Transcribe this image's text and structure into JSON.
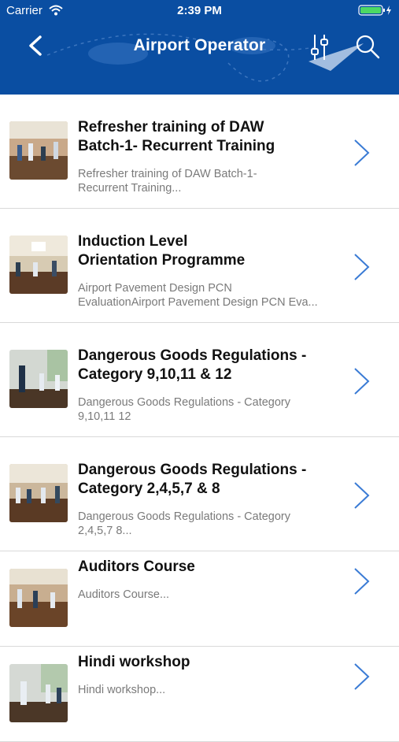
{
  "status": {
    "carrier": "Carrier",
    "time": "2:39 PM"
  },
  "nav": {
    "title": "Airport Operator"
  },
  "items": [
    {
      "title_line1": "Refresher training of DAW",
      "title_line2": "Batch-1- Recurrent Training",
      "sub_line1": "Refresher training of DAW Batch-1-",
      "sub_line2": "Recurrent Training..."
    },
    {
      "title_line1": "Induction Level",
      "title_line2": "Orientation Programme",
      "sub_line1": "Airport Pavement Design  PCN",
      "sub_line2": "EvaluationAirport Pavement Design  PCN Eva..."
    },
    {
      "title_line1": "Dangerous Goods Regulations -",
      "title_line2": "Category 9,10,11 & 12",
      "sub_line1": "Dangerous Goods Regulations - Category",
      "sub_line2": "9,10,11  12"
    },
    {
      "title_line1": "Dangerous Goods Regulations -",
      "title_line2": "Category 2,4,5,7 & 8",
      "sub_line1": "Dangerous Goods Regulations - Category",
      "sub_line2": "2,4,5,7  8..."
    },
    {
      "title_line1": "Auditors Course",
      "sub_line1": "Auditors Course..."
    },
    {
      "title_line1": "Hindi workshop",
      "sub_line1": "Hindi workshop..."
    }
  ]
}
